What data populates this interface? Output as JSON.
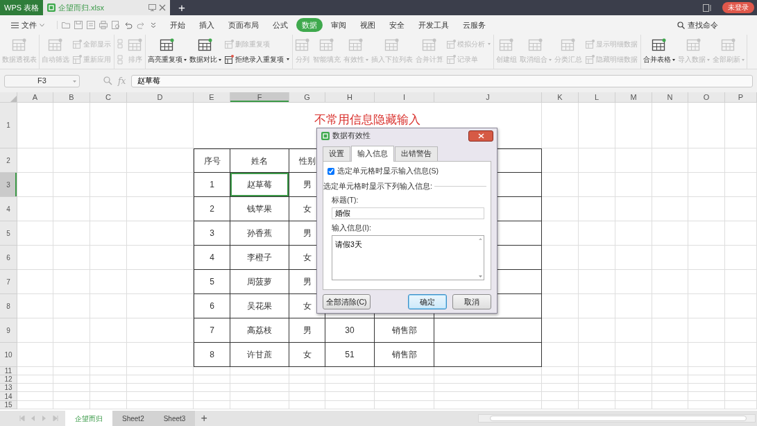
{
  "title_bar": {
    "app_tab": "WPS 表格",
    "doc_tab": "企望而归.xlsx",
    "new_tab": "+",
    "login": "未登录"
  },
  "menu": {
    "file": "文件",
    "tabs": [
      {
        "label": "开始",
        "selected": false
      },
      {
        "label": "插入",
        "selected": false
      },
      {
        "label": "页面布局",
        "selected": false
      },
      {
        "label": "公式",
        "selected": false
      },
      {
        "label": "数据",
        "selected": true
      },
      {
        "label": "审阅",
        "selected": false
      },
      {
        "label": "视图",
        "selected": false
      },
      {
        "label": "安全",
        "selected": false
      },
      {
        "label": "开发工具",
        "selected": false
      },
      {
        "label": "云服务",
        "selected": false
      }
    ],
    "search": "查找命令"
  },
  "ribbon": [
    {
      "items": [
        {
          "kind": "large",
          "label": "数据透视表",
          "disabled": true,
          "dropdown": false
        }
      ]
    },
    {
      "items": [
        {
          "kind": "large",
          "label": "自动筛选",
          "disabled": true,
          "dropdown": false
        },
        {
          "kind": "stack",
          "items": [
            {
              "label": "全部显示",
              "disabled": true,
              "dropdown": false
            },
            {
              "label": "重新应用",
              "disabled": true,
              "dropdown": false
            }
          ]
        }
      ]
    },
    {
      "items": [
        {
          "kind": "stack",
          "items": [
            {
              "disabled": true,
              "dropdown": false
            },
            {
              "disabled": true,
              "dropdown": false
            }
          ]
        },
        {
          "kind": "large",
          "label": "排序",
          "disabled": true,
          "dropdown": false
        }
      ]
    },
    {
      "items": [
        {
          "kind": "large",
          "label": "高亮重复项",
          "disabled": false,
          "dropdown": true
        },
        {
          "kind": "large",
          "label": "数据对比",
          "disabled": false,
          "dropdown": true
        },
        {
          "kind": "stack",
          "items": [
            {
              "label": "删除重复项",
              "disabled": true,
              "dropdown": false
            },
            {
              "label": "拒绝录入重复项",
              "disabled": false,
              "dropdown": true
            }
          ]
        }
      ]
    },
    {
      "items": [
        {
          "kind": "large",
          "label": "分列",
          "disabled": true,
          "dropdown": false
        },
        {
          "kind": "large",
          "label": "智能填充",
          "disabled": true,
          "dropdown": false
        },
        {
          "kind": "large",
          "label": "有效性",
          "disabled": true,
          "dropdown": true
        },
        {
          "kind": "large",
          "label": "插入下拉列表",
          "disabled": true,
          "dropdown": false
        },
        {
          "kind": "large",
          "label": "合并计算",
          "disabled": true,
          "dropdown": false
        },
        {
          "kind": "stack",
          "items": [
            {
              "label": "模拟分析",
              "disabled": true,
              "dropdown": true
            },
            {
              "label": "记录单",
              "disabled": true,
              "dropdown": false
            }
          ]
        }
      ]
    },
    {
      "items": [
        {
          "kind": "large",
          "label": "创建组",
          "disabled": true,
          "dropdown": false
        },
        {
          "kind": "large",
          "label": "取消组合",
          "disabled": true,
          "dropdown": true
        },
        {
          "kind": "large",
          "label": "分类汇总",
          "disabled": true,
          "dropdown": false
        },
        {
          "kind": "stack",
          "items": [
            {
              "label": "显示明细数据",
              "disabled": true,
              "dropdown": false
            },
            {
              "label": "隐藏明细数据",
              "disabled": true,
              "dropdown": false
            }
          ]
        }
      ]
    },
    {
      "items": [
        {
          "kind": "large",
          "label": "合并表格",
          "disabled": false,
          "dropdown": true
        },
        {
          "kind": "large",
          "label": "导入数据",
          "disabled": true,
          "dropdown": true
        },
        {
          "kind": "large",
          "label": "全部刷新",
          "disabled": true,
          "dropdown": true
        }
      ]
    }
  ],
  "formula_bar": {
    "cell_ref": "F3",
    "fx": "fx",
    "value": "赵草莓"
  },
  "columns": [
    {
      "label": "A",
      "selected": false
    },
    {
      "label": "B",
      "selected": false
    },
    {
      "label": "C",
      "selected": false
    },
    {
      "label": "D",
      "selected": false
    },
    {
      "label": "E",
      "selected": false
    },
    {
      "label": "F",
      "selected": true
    },
    {
      "label": "G",
      "selected": false
    },
    {
      "label": "H",
      "selected": false
    },
    {
      "label": "I",
      "selected": false
    },
    {
      "label": "J",
      "selected": false
    },
    {
      "label": "K",
      "selected": false
    },
    {
      "label": "L",
      "selected": false
    },
    {
      "label": "M",
      "selected": false
    },
    {
      "label": "N",
      "selected": false
    },
    {
      "label": "O",
      "selected": false
    },
    {
      "label": "P",
      "selected": false
    }
  ],
  "rows": [
    {
      "label": "1",
      "selected": false
    },
    {
      "label": "2",
      "selected": false
    },
    {
      "label": "3",
      "selected": true
    },
    {
      "label": "4",
      "selected": false
    },
    {
      "label": "5",
      "selected": false
    },
    {
      "label": "6",
      "selected": false
    },
    {
      "label": "7",
      "selected": false
    },
    {
      "label": "8",
      "selected": false
    },
    {
      "label": "9",
      "selected": false
    },
    {
      "label": "10",
      "selected": false
    },
    {
      "label": "11",
      "selected": false
    },
    {
      "label": "12",
      "selected": false
    },
    {
      "label": "13",
      "selected": false
    },
    {
      "label": "14",
      "selected": false
    },
    {
      "label": "15",
      "selected": false
    }
  ],
  "sheet": {
    "title": "不常用信息隐藏输入",
    "table": {
      "header": [
        "序号",
        "姓名",
        "性别"
      ],
      "rows": [
        {
          "cells": [
            "1",
            "赵草莓",
            "男"
          ],
          "selected": true
        },
        {
          "cells": [
            "2",
            "钱苹果",
            "女"
          ],
          "selected": false
        },
        {
          "cells": [
            "3",
            "孙香蕉",
            "男"
          ],
          "selected": false
        },
        {
          "cells": [
            "4",
            "李橙子",
            "女"
          ],
          "selected": false
        },
        {
          "cells": [
            "5",
            "周菠萝",
            "男"
          ],
          "selected": false
        },
        {
          "cells": [
            "6",
            "吴花果",
            "女"
          ],
          "selected": false
        },
        {
          "cells": [
            "7",
            "高荔枝",
            "男",
            "30",
            "销售部"
          ],
          "selected": false
        },
        {
          "cells": [
            "8",
            "许甘蔗",
            "女",
            "51",
            "销售部"
          ],
          "selected": false
        }
      ]
    }
  },
  "dialog": {
    "title": "数据有效性",
    "tabs": [
      {
        "label": "设置",
        "selected": false
      },
      {
        "label": "输入信息",
        "selected": true
      },
      {
        "label": "出错警告",
        "selected": false
      }
    ],
    "show_input": {
      "label": "选定单元格时显示输入信息(S)",
      "checked": true
    },
    "group_label": "选定单元格时显示下列输入信息:",
    "title_label": "标题(T):",
    "title_value": "婚假",
    "message_label": "输入信息(I):",
    "message_value": "请假3天",
    "buttons": [
      {
        "label": "全部清除(C)",
        "default": false
      },
      {
        "label": "确定",
        "default": true
      },
      {
        "label": "取消",
        "default": false
      }
    ]
  },
  "sheet_tabs": [
    {
      "label": "企望而归",
      "selected": true
    },
    {
      "label": "Sheet2",
      "selected": false
    },
    {
      "label": "Sheet3",
      "selected": false
    }
  ],
  "add_sheet": "+"
}
